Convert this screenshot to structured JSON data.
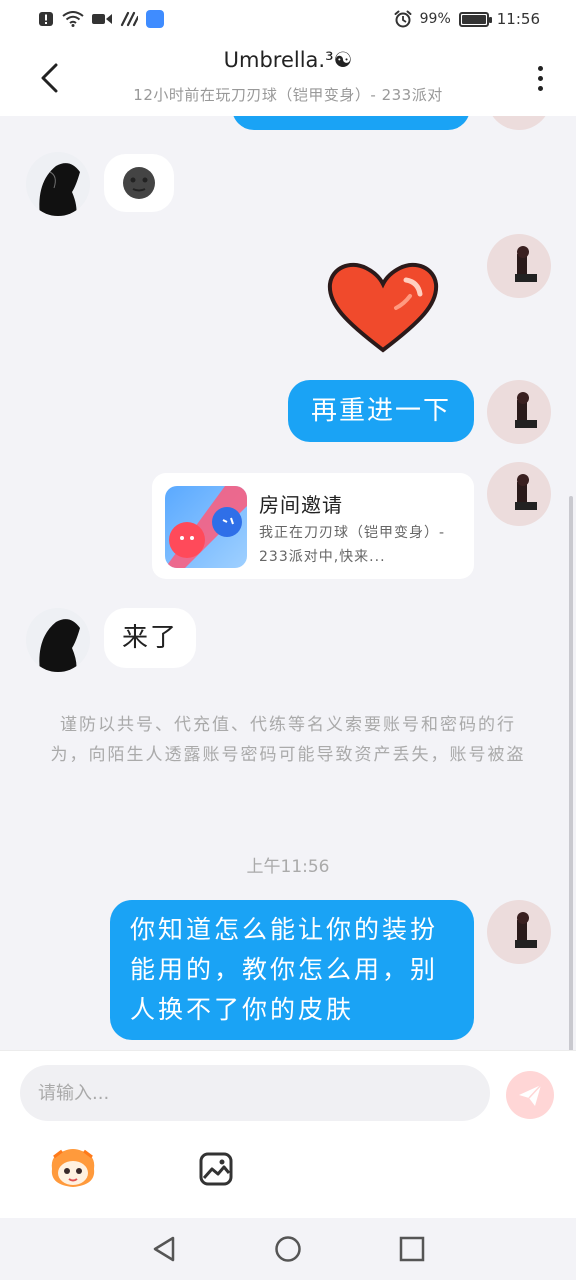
{
  "status_bar": {
    "time": "11:56",
    "battery_percent": "99%",
    "battery_level": 0.99,
    "icons": [
      "notification-alert-icon",
      "wifi-icon",
      "video-icon",
      "nfc-icon",
      "app-store-icon",
      "alarm-icon",
      "battery-icon"
    ]
  },
  "header": {
    "title": "Umbrella.³☯",
    "subtitle": "12小时前在玩刀刃球（铠甲变身）- 233派对",
    "back_icon": "back-arrow-icon",
    "more_icon": "more-vertical-icon"
  },
  "messages": [
    {
      "from": "other",
      "type": "emoji",
      "content": "🌚"
    },
    {
      "from": "me",
      "type": "sticker",
      "content": "heart"
    },
    {
      "from": "me",
      "type": "text",
      "content": "再重进一下"
    },
    {
      "from": "me",
      "type": "invite",
      "title": "房间邀请",
      "desc": "我正在刀刃球（铠甲变身）- 233派对中,快来..."
    },
    {
      "from": "other",
      "type": "text",
      "content": "来了"
    }
  ],
  "notice": "谨防以共号、代充值、代练等名义索要账号和密码的行为，向陌生人透露账号密码可能导致资产丢失，账号被盗",
  "time_label": "上午11:56",
  "last_message": {
    "from": "me",
    "type": "text",
    "content": "你知道怎么能让你的装扮能用的，教你怎么用，别人换不了你的皮肤"
  },
  "input": {
    "placeholder": "请输入..."
  },
  "toolbar": {
    "emoji_icon": "emoji-face-icon",
    "image_icon": "image-icon",
    "send_icon": "send-icon"
  },
  "nav": {
    "back": "nav-back-icon",
    "home": "nav-home-icon",
    "recents": "nav-recents-icon"
  },
  "colors": {
    "bubble_out": "#1aa3f5",
    "bubble_in": "#ffffff",
    "background": "#f3f3f7",
    "send_button": "#ffd6d6"
  }
}
